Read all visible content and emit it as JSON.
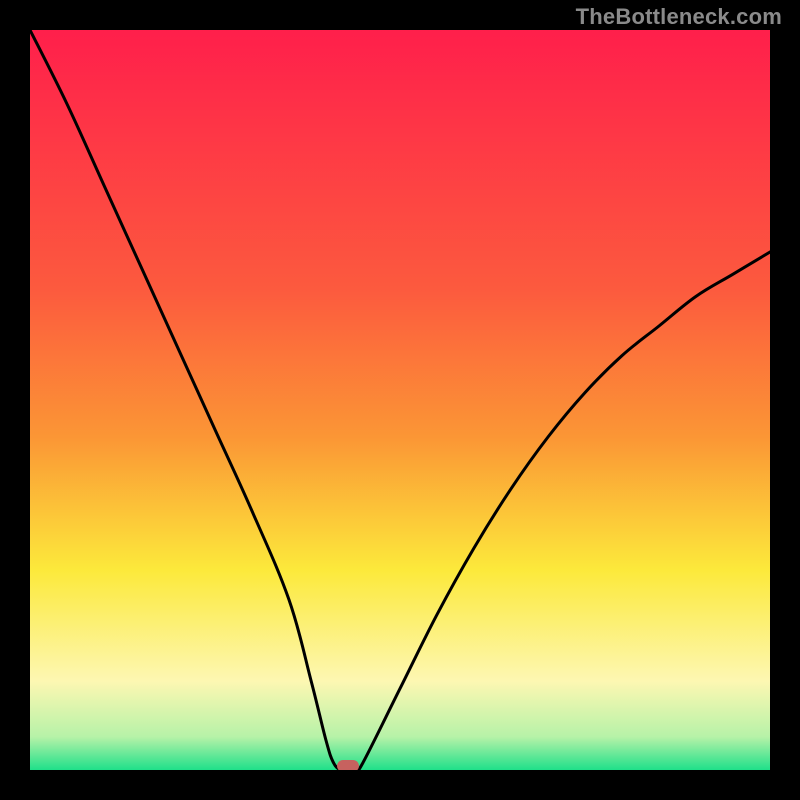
{
  "watermark": {
    "text": "TheBottleneck.com"
  },
  "colors": {
    "black": "#000000",
    "marker": "#c7625f",
    "curve": "#000000",
    "green_bottom": "#1fe08a",
    "green_pale": "#b7f2a8",
    "yellow_pale": "#fdf7b2",
    "yellow": "#fce93b",
    "orange": "#fb9635",
    "red_orange": "#fc5a3e",
    "red_top": "#ff1f4b"
  },
  "chart_data": {
    "type": "line",
    "title": "",
    "xlabel": "",
    "ylabel": "",
    "xlim": [
      0,
      100
    ],
    "ylim": [
      0,
      100
    ],
    "x": [
      0,
      5,
      10,
      15,
      20,
      25,
      30,
      35,
      38,
      40,
      41,
      42,
      43,
      44,
      45,
      50,
      55,
      60,
      65,
      70,
      75,
      80,
      85,
      90,
      95,
      100
    ],
    "series": [
      {
        "name": "bottleneck-curve",
        "values": [
          100,
          90,
          79,
          68,
          57,
          46,
          35,
          23,
          12,
          4,
          1,
          0,
          0,
          0,
          1,
          11,
          21,
          30,
          38,
          45,
          51,
          56,
          60,
          64,
          67,
          70
        ]
      }
    ],
    "marker": {
      "x": 43,
      "y": 0
    },
    "gradient_stops": [
      {
        "offset": 0.0,
        "color_key": "red_top"
      },
      {
        "offset": 0.35,
        "color_key": "red_orange"
      },
      {
        "offset": 0.55,
        "color_key": "orange"
      },
      {
        "offset": 0.73,
        "color_key": "yellow"
      },
      {
        "offset": 0.88,
        "color_key": "yellow_pale"
      },
      {
        "offset": 0.955,
        "color_key": "green_pale"
      },
      {
        "offset": 1.0,
        "color_key": "green_bottom"
      }
    ]
  }
}
